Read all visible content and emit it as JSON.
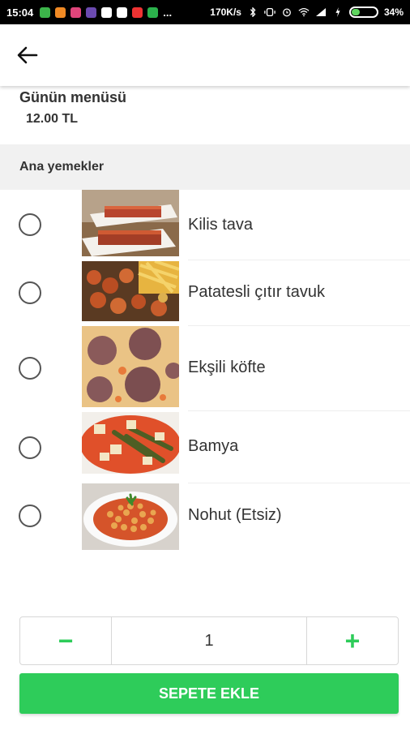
{
  "status_bar": {
    "time": "15:04",
    "dots": "...",
    "network_speed": "170K/s",
    "battery_percent": "34%",
    "battery_level": 0.34,
    "icons": [
      "bluetooth-icon",
      "vibrate-icon",
      "alarm-icon",
      "wifi-icon",
      "signal-icon",
      "charging-icon"
    ]
  },
  "app_bar": {
    "back_icon": "arrow-left-icon"
  },
  "menu": {
    "title": "Günün menüsü",
    "price": "12.00 TL"
  },
  "section": {
    "title": "Ana yemekler"
  },
  "items": [
    {
      "label": "Kilis tava",
      "selected": false,
      "image": "kilis-tava-photo"
    },
    {
      "label": "Patatesli çıtır tavuk",
      "selected": false,
      "image": "crispy-chicken-fries-photo"
    },
    {
      "label": "Ekşili köfte",
      "selected": false,
      "image": "meatball-soup-photo"
    },
    {
      "label": "Bamya",
      "selected": false,
      "image": "okra-stew-photo"
    },
    {
      "label": "Nohut (Etsiz)",
      "selected": false,
      "image": "chickpea-stew-photo"
    }
  ],
  "quantity": {
    "minus": "−",
    "value": "1",
    "plus": "+"
  },
  "add_to_cart": {
    "label": "SEPETE EKLE"
  },
  "colors": {
    "accent": "#2ecc5a",
    "section_bg": "#f1f1f1",
    "text": "#333333"
  }
}
